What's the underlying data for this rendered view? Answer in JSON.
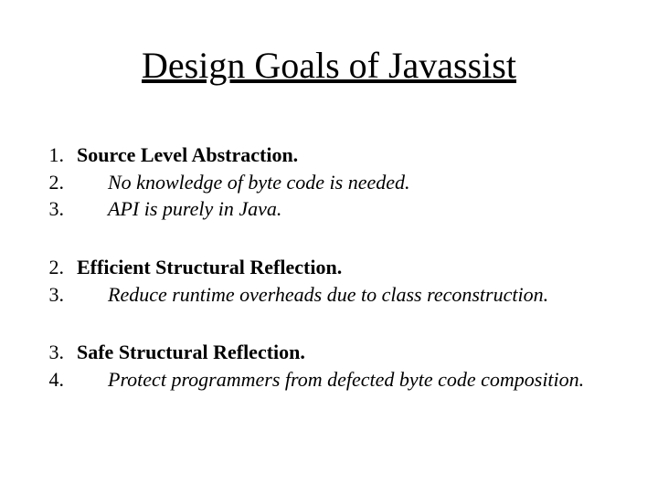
{
  "title": "Design Goals of Javassist",
  "g1": {
    "num": "1.",
    "heading": "Source Level Abstraction.",
    "s1num": "2.",
    "s1txt": "No knowledge of byte code is needed.",
    "s2num": "3.",
    "s2txt": "API is purely in Java."
  },
  "g2": {
    "num": "2.",
    "heading": "Efficient Structural Reflection.",
    "s1num": "3.",
    "s1txt": "Reduce runtime overheads due to class reconstruction."
  },
  "g3": {
    "num": "3.",
    "heading": "Safe Structural Reflection.",
    "s1num": "4.",
    "s1txt": "Protect programmers from defected byte code composition."
  }
}
